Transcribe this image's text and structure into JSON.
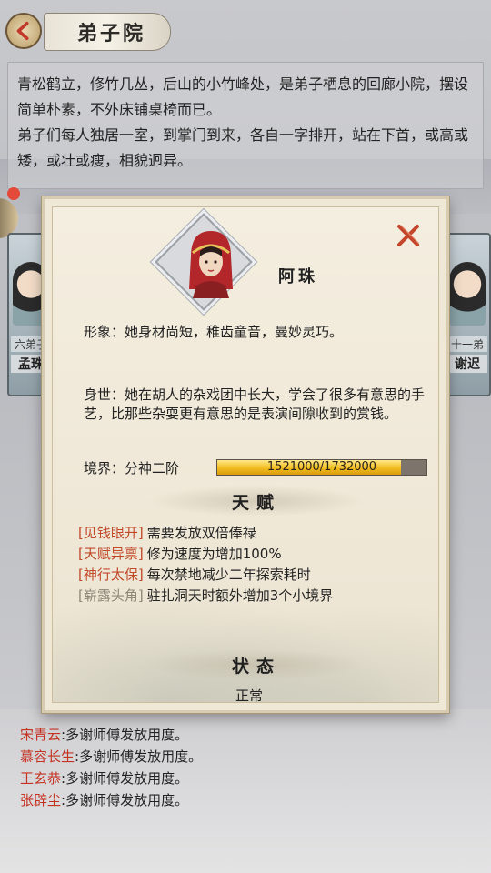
{
  "header": {
    "title": "弟子院"
  },
  "story": {
    "paragraph_1": "青松鹤立，修竹几丛，后山的小竹峰处，是弟子栖息的回廊小院，摆设简单朴素，不外床铺桌椅而已。",
    "paragraph_2": "弟子们每人独居一室，到掌门到来，各自一字排开，站在下首，或高或矮，或壮或瘦，相貌迥异。"
  },
  "side_cards": {
    "left": {
      "rank_label": "六弟子",
      "name": "孟珠"
    },
    "right": {
      "rank_label": "十一弟",
      "name": "谢迟"
    }
  },
  "modal": {
    "character_name": "阿珠",
    "appearance": "形象：她身材尚短，稚齿童音，曼妙灵巧。",
    "background": "身世：她在胡人的杂戏团中长大，学会了很多有意思的手艺，比那些杂耍更有意思的是表演间隙收到的赏钱。",
    "realm_label": "境界：分神二阶",
    "realm_progress": {
      "current": 1521000,
      "max": 1732000,
      "text": "1521000/1732000",
      "fraction": 0.878
    },
    "talent_heading": "天赋",
    "talents": [
      {
        "tag": "[见钱眼开]",
        "desc": "需要发放双倍俸禄",
        "tag_color": "#c14a2b"
      },
      {
        "tag": "[天赋异禀]",
        "desc": "修为速度为增加100%",
        "tag_color": "#c14a2b"
      },
      {
        "tag": "[神行太保]",
        "desc": "每次禁地减少二年探索耗时",
        "tag_color": "#c14a2b"
      },
      {
        "tag": "[崭露头角]",
        "desc": "驻扎洞天时额外增加3个小境界",
        "tag_color": "#8f8678"
      }
    ],
    "status_heading": "状态",
    "status_value": "正常"
  },
  "log": [
    {
      "who": "宋青云",
      "text": ":多谢师傅发放用度。"
    },
    {
      "who": "慕容长生",
      "text": ":多谢师傅发放用度。"
    },
    {
      "who": "王玄恭",
      "text": ":多谢师傅发放用度。"
    },
    {
      "who": "张辟尘",
      "text": ":多谢师傅发放用度。"
    }
  ],
  "colors": {
    "accent_red": "#c43222",
    "progress_gold": "#f1bc1e",
    "modal_bg": "#efe8d6"
  }
}
